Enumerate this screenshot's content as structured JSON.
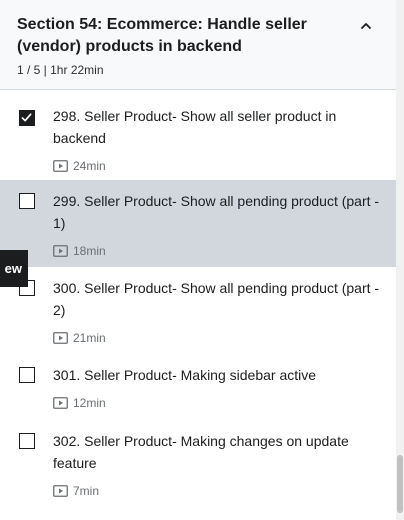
{
  "section": {
    "title": "Section 54: Ecommerce: Handle seller (vendor) products in backend",
    "meta": "1 / 5 | 1hr 22min"
  },
  "lectures": [
    {
      "title": "298. Seller Product- Show all seller product in backend",
      "duration": "24min",
      "completed": true,
      "active": false
    },
    {
      "title": "299. Seller Product- Show all pending product (part - 1)",
      "duration": "18min",
      "completed": false,
      "active": true
    },
    {
      "title": "300. Seller Product- Show all pending product (part - 2)",
      "duration": "21min",
      "completed": false,
      "active": false
    },
    {
      "title": "301. Seller Product- Making sidebar active",
      "duration": "12min",
      "completed": false,
      "active": false
    },
    {
      "title": "302. Seller Product- Making changes on update feature",
      "duration": "7min",
      "completed": false,
      "active": false
    }
  ],
  "overlay_tab": {
    "label": "ew"
  },
  "icons": {
    "collapse": "chevron-up-icon",
    "check": "check-icon",
    "video": "video-icon"
  },
  "colors": {
    "active_row": "#d1d7dc",
    "text": "#1c1d1f",
    "muted": "#6a6f73",
    "header_bg": "#f7f9fa"
  }
}
